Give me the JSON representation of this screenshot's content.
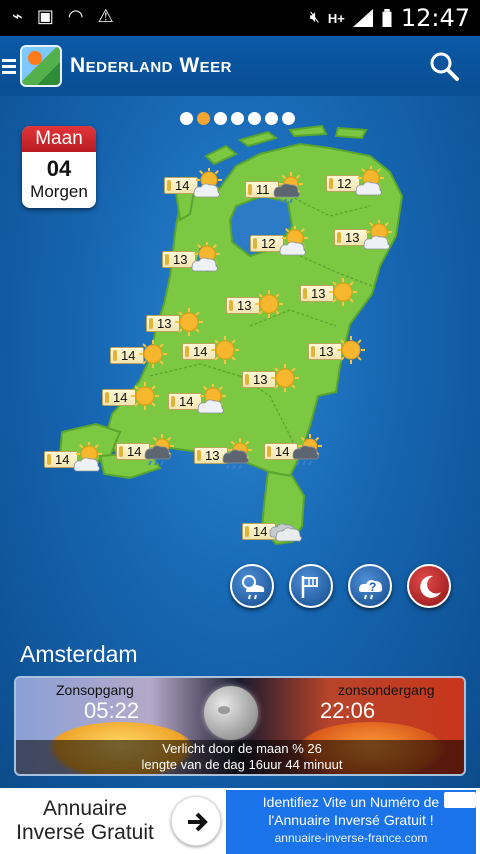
{
  "status_bar": {
    "time": "12:47"
  },
  "app": {
    "title": "Nederland Weer"
  },
  "pager": {
    "count": 7,
    "active_index": 1
  },
  "calendar": {
    "month": "Maan",
    "day": "04",
    "relative": "Morgen"
  },
  "forecast": [
    {
      "temp": "14",
      "icon": "sun-cloud-icon"
    },
    {
      "temp": "11",
      "icon": "rain-cloud-icon"
    },
    {
      "temp": "12",
      "icon": "sun-cloud-icon"
    },
    {
      "temp": "12",
      "icon": "sun-cloud-icon"
    },
    {
      "temp": "13",
      "icon": "sun-cloud-icon"
    },
    {
      "temp": "13",
      "icon": "sun-cloud-icon"
    },
    {
      "temp": "13",
      "icon": "sun-icon"
    },
    {
      "temp": "13",
      "icon": "sun-icon"
    },
    {
      "temp": "13",
      "icon": "sun-icon"
    },
    {
      "temp": "14",
      "icon": "sun-icon"
    },
    {
      "temp": "14",
      "icon": "sun-icon"
    },
    {
      "temp": "13",
      "icon": "sun-icon"
    },
    {
      "temp": "13",
      "icon": "sun-icon"
    },
    {
      "temp": "14",
      "icon": "sun-icon"
    },
    {
      "temp": "14",
      "icon": "sun-cloud-icon"
    },
    {
      "temp": "14",
      "icon": "sun-cloud-icon"
    },
    {
      "temp": "14",
      "icon": "rain-cloud-icon"
    },
    {
      "temp": "13",
      "icon": "rain-cloud-icon"
    },
    {
      "temp": "14",
      "icon": "rain-cloud-icon"
    },
    {
      "temp": "14",
      "icon": "cloud-icon"
    }
  ],
  "mode_buttons": [
    {
      "icon": "sun-cloud-rain-icon"
    },
    {
      "icon": "wind-icon"
    },
    {
      "icon": "cloud-question-icon"
    },
    {
      "icon": "moon-icon"
    }
  ],
  "location": {
    "city": "Amsterdam"
  },
  "sun": {
    "sunrise_label": "Zonsopgang",
    "sunrise_time": "05:22",
    "sunset_label": "zonsondergang",
    "sunset_time": "22:06",
    "moon_line": "Verlicht door de maan % 26",
    "daylength_line": "lengte van de dag   16uur   44 minuut"
  },
  "ad": {
    "left_line1": "Annuaire",
    "left_line2": "Inversé Gratuit",
    "right_line1": "Identifiez Vite un Numéro de",
    "right_line2": "l'Annuaire Inversé Gratuit !",
    "url": "annuaire-inverse-france.com"
  },
  "colors": {
    "app_bar": "#0a5aa8",
    "land": "#7cc843",
    "sea": "#1666b2",
    "active_dot": "#f2a531",
    "calendar_header": "#d22a30"
  }
}
